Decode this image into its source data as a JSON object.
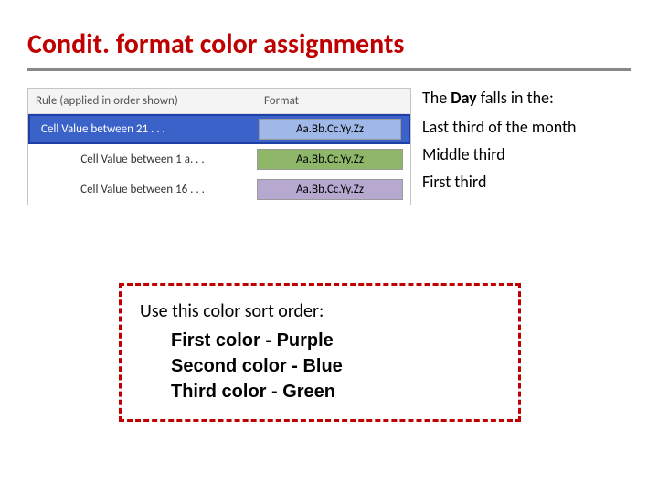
{
  "title": "Condit. format color assignments",
  "rules": {
    "header_rule": "Rule (applied in order shown)",
    "header_format": "Format",
    "sample": "Aa.Bb.Cc.Yy.Zz",
    "rows": [
      {
        "label": "Cell Value between 21 . . .",
        "swatch_bg": "#9fb8e8",
        "selected": true
      },
      {
        "label": "Cell Value between 1 a. . .",
        "swatch_bg": "#8fb769",
        "selected": false
      },
      {
        "label": "Cell Value between 16 . . .",
        "swatch_bg": "#b6a8cf",
        "selected": false
      }
    ]
  },
  "explain": {
    "heading_prefix": "The ",
    "heading_bold": "Day",
    "heading_suffix": " falls in the:",
    "items": [
      "Last third of the month",
      "Middle third",
      "First third"
    ]
  },
  "callout": {
    "line1": "Use this color sort order:",
    "lines": [
      "First color - Purple",
      "Second color - Blue",
      "Third color - Green"
    ]
  }
}
